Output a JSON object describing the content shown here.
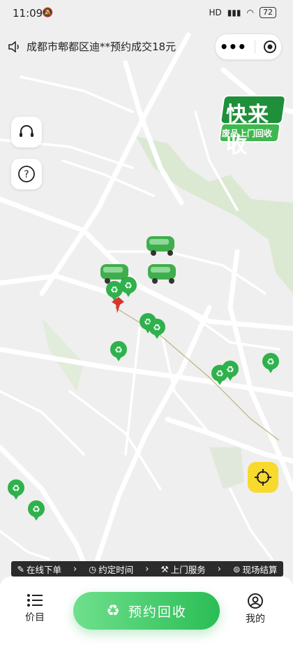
{
  "status": {
    "time": "11:09",
    "network": "HD",
    "battery": "72"
  },
  "notice": {
    "text": "成都市郫都区迪**预约成交18元"
  },
  "brand": {
    "line1": "快来收",
    "line2": "废品上门回收"
  },
  "steps": [
    {
      "label": "在线下单",
      "icon": "pencil-icon"
    },
    {
      "label": "约定时间",
      "icon": "clock-icon"
    },
    {
      "label": "上门服务",
      "icon": "wrench-icon"
    },
    {
      "label": "现场结算",
      "icon": "coin-icon"
    }
  ],
  "bottom": {
    "left_tab": "价目",
    "center_button": "预约回收",
    "right_tab": "我的"
  },
  "colors": {
    "primary_green": "#2bbd55",
    "locate_yellow": "#f8d92d",
    "steps_bg": "#2b2b2b"
  }
}
